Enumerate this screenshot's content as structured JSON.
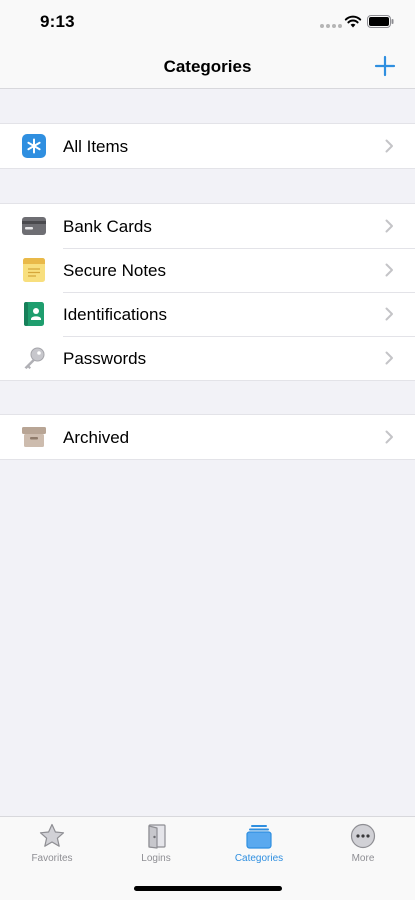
{
  "status_bar": {
    "time": "9:13"
  },
  "nav": {
    "title": "Categories"
  },
  "colors": {
    "accent": "#2f8fe0",
    "chevron": "#c4c4c7",
    "tab_inactive": "#8e8e93"
  },
  "groups": [
    {
      "rows": [
        {
          "label": "All Items",
          "icon": "asterisk-icon"
        }
      ]
    },
    {
      "rows": [
        {
          "label": "Bank Cards",
          "icon": "credit-card-icon"
        },
        {
          "label": "Secure Notes",
          "icon": "note-icon"
        },
        {
          "label": "Identifications",
          "icon": "id-card-icon"
        },
        {
          "label": "Passwords",
          "icon": "key-icon"
        }
      ]
    },
    {
      "rows": [
        {
          "label": "Archived",
          "icon": "archive-box-icon"
        }
      ]
    }
  ],
  "tabs": [
    {
      "label": "Favorites",
      "icon": "star-icon",
      "active": false
    },
    {
      "label": "Logins",
      "icon": "door-icon",
      "active": false
    },
    {
      "label": "Categories",
      "icon": "stack-icon",
      "active": true
    },
    {
      "label": "More",
      "icon": "ellipsis-icon",
      "active": false
    }
  ]
}
